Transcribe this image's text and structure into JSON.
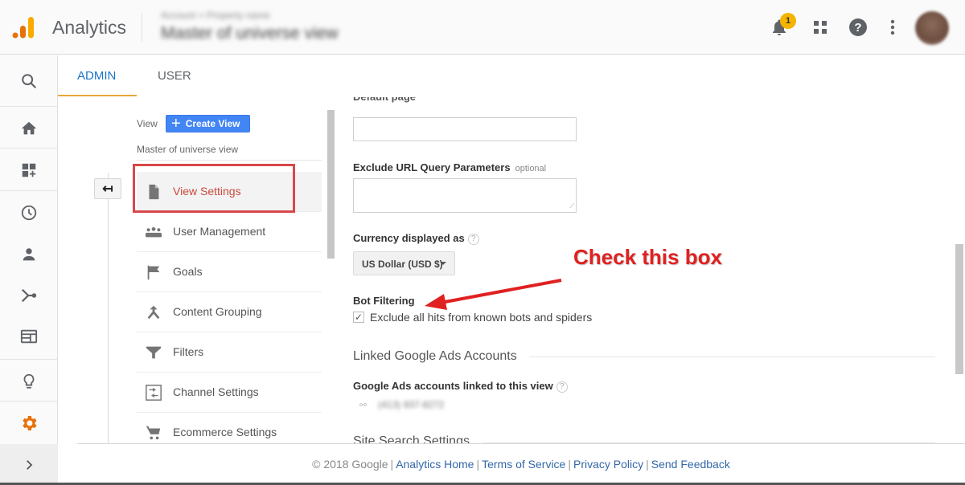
{
  "header": {
    "app_title": "Analytics",
    "account_path": "Account > Property name",
    "view_selector": "Master of universe view",
    "notification_count": "1",
    "icons": [
      "bell-icon",
      "apps-grid-icon",
      "help-icon",
      "more-vert-icon",
      "avatar"
    ]
  },
  "left_nav": {
    "items": [
      "search-icon",
      "home-icon",
      "customization-icon",
      "realtime-clock-icon",
      "audience-person-icon",
      "acquisition-icon",
      "behavior-icon",
      "discover-bulb-icon",
      "admin-gear-icon"
    ],
    "expand_icon": "chevron-right-icon",
    "active_color": "#e8710a"
  },
  "tabs": [
    {
      "label": "ADMIN",
      "active": true
    },
    {
      "label": "USER",
      "active": false
    }
  ],
  "view_column": {
    "label": "View",
    "create_button": "Create View",
    "view_name": "Master of universe view",
    "back_icon": "back-arrow-icon",
    "menu": [
      {
        "label": "View Settings",
        "icon": "document-icon",
        "active": true
      },
      {
        "label": "User Management",
        "icon": "people-icon"
      },
      {
        "label": "Goals",
        "icon": "flag-icon"
      },
      {
        "label": "Content Grouping",
        "icon": "merge-icon"
      },
      {
        "label": "Filters",
        "icon": "filter-icon"
      },
      {
        "label": "Channel Settings",
        "icon": "channel-icon"
      },
      {
        "label": "Ecommerce Settings",
        "icon": "cart-icon"
      }
    ]
  },
  "settings": {
    "cut_label": "Default page",
    "default_page_value": "",
    "exclude_params_label": "Exclude URL Query Parameters",
    "exclude_params_optional": "optional",
    "exclude_params_value": "",
    "currency_label": "Currency displayed as",
    "currency_value": "US Dollar (USD $)",
    "bot_filtering_label": "Bot Filtering",
    "bot_filtering_checkbox": "Exclude all hits from known bots and spiders",
    "bot_filtering_checked": true,
    "linked_ads_section": "Linked Google Ads Accounts",
    "linked_ads_label": "Google Ads accounts linked to this view",
    "linked_ads_account": "(413) 937-8272",
    "site_search_section": "Site Search Settings"
  },
  "annotation": {
    "text": "Check this box",
    "color": "#e02121"
  },
  "footer": {
    "copyright": "© 2018 Google",
    "links": [
      "Analytics Home",
      "Terms of Service",
      "Privacy Policy",
      "Send Feedback"
    ]
  }
}
